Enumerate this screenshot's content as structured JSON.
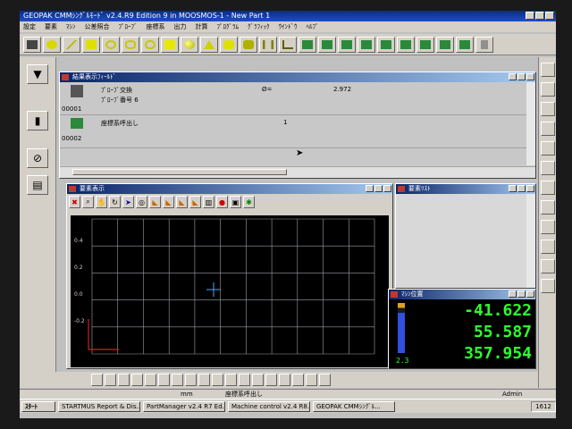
{
  "window": {
    "title": "GEOPAK CMMｼﾝｸﾞﾙﾓｰﾄﾞ v2.4.R9 Edition 9 in MOOSMOS-1 - New Part 1"
  },
  "menu": [
    "設定",
    "要素",
    "ﾏｼﾝ",
    "公差照合",
    "ﾌﾟﾛｰﾌﾞ",
    "座標系",
    "出力",
    "計算",
    "ﾌﾟﾛｸﾞﾗﾑ",
    "ｸﾞﾗﾌｨｯｸ",
    "ｳｲﾝﾄﾞｳ",
    "ﾍﾙﾌﾟ"
  ],
  "program_window": {
    "title": "結果表示ﾌｨｰﾙﾄﾞ",
    "rows": [
      {
        "num": "00001",
        "line1": "ﾌﾟﾛｰﾌﾞ交換",
        "line2": "ﾌﾟﾛｰﾌﾞ番号  6",
        "param": "Ø=",
        "value": "2.972"
      },
      {
        "num": "00002",
        "line1": "座標系呼出し",
        "line2": "",
        "param": "",
        "value": "1"
      }
    ]
  },
  "graphic_window": {
    "title": "要素表示"
  },
  "element_list_window": {
    "title": "要素ﾘｽﾄ"
  },
  "machine_position_window": {
    "title": "ﾏｼﾝ位置",
    "x": "-41.622",
    "y": "55.587",
    "z": "357.954",
    "probe_label": "2.3"
  },
  "chart_data": {
    "type": "scatter",
    "y_tick_labels": [
      "0.4",
      "0.2",
      "0.0",
      "-0.2"
    ],
    "grid": true,
    "series": []
  },
  "status": {
    "unit": "mm",
    "message": "座標系呼出し",
    "user": "Admin"
  },
  "taskbar": {
    "start": "ｽﾀｰﾄ",
    "items": [
      "STARTMUS Report & Dis...",
      "PartManager v2.4 R7 Ed...",
      "Machine control v2.4 R8...",
      "GEOPAK CMMｼﾝｸﾞﾙ..."
    ],
    "time": "1612"
  },
  "colors": {
    "readout_text": "#2bff2b",
    "plot_bg": "#000000",
    "grid": "#9aa0a8",
    "title_active": "#0a246a"
  }
}
